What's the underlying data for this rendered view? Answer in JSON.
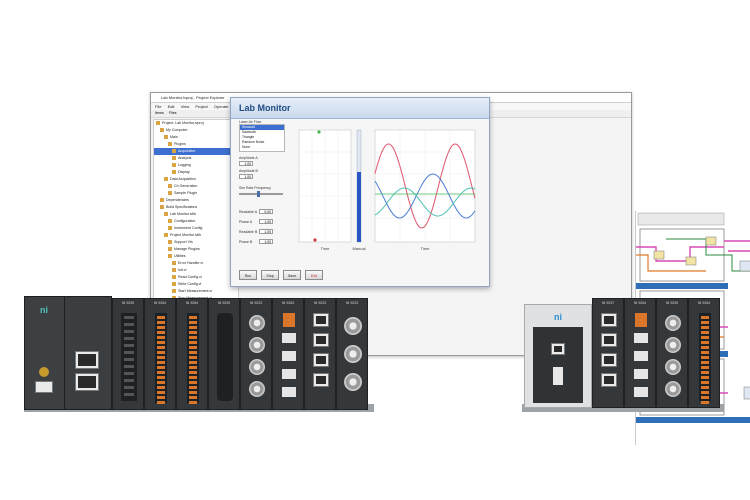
{
  "project_window": {
    "title": "Lab Monitor.lvproj - Project Explorer",
    "menu": [
      "File",
      "Edit",
      "View",
      "Project",
      "Operate",
      "Tools",
      "Window",
      "Help"
    ],
    "tabs": [
      "Items",
      "Files"
    ],
    "tree_items": [
      "Project: Lab Monitor.lvproj",
      "My Computer",
      "Main",
      "Plugins",
      "Acquisition",
      "Analysis",
      "Logging",
      "Display",
      "Data Acquisition",
      "Ch Generation",
      "Sample Plugin",
      "Dependencies",
      "Build Specifications",
      "Lab Monitor.lvlib",
      "Configuration",
      "Instrument Config",
      "Project Monitor.lvlib",
      "Support VIs",
      "Manage Plugins",
      "Utilities",
      "Error Handler.vi",
      "Init.vi",
      "Read Config.vi",
      "Write Config.vi",
      "Start Measurement.vi",
      "Stop Measurement.vi",
      "Dependencies",
      "Build Specifications",
      "Plugin Management",
      "Load Plugins.vi",
      "Unload Plugins.vi",
      "Plugin Manager.vi"
    ]
  },
  "lab_window": {
    "title": "Lab Monitor",
    "list_label": "Laser Air Flow",
    "list_items": [
      "Sinusoid",
      "Sawtooth",
      "Triangle",
      "Random Noise",
      "None"
    ],
    "amplitude_label_1": "Amplitude A",
    "amplitude_label_2": "Amplitude B",
    "amplitude_value_1": "1.00",
    "amplitude_value_2": "1.00",
    "frequency_label": "Sim Rate Frequency",
    "params": [
      {
        "label": "Readable A",
        "value": "0.00"
      },
      {
        "label": "Phase A",
        "value": "1.00"
      },
      {
        "label": "Readable B",
        "value": "1.00"
      },
      {
        "label": "Phase B",
        "value": "1.00"
      }
    ],
    "buttons": [
      "Run",
      "Stop",
      "Save",
      "Exit"
    ],
    "chart_xlabel_left": "Time",
    "chart_xlabel_mid": "Manual",
    "chart_xlabel_right": "Time"
  },
  "hardware": {
    "left_chassis_logo": "ni",
    "right_chassis_logo": "ni",
    "module_labels": [
      "NI 9205",
      "NI 9264",
      "NI 9264",
      "NI 9205",
      "NI 9223",
      "NI 9263",
      "NI 9223",
      "NI 9223",
      "NI 9227"
    ],
    "right_module_labels": [
      "NI 9237",
      "NI 9264",
      "NI 9205",
      "NI 9264"
    ]
  },
  "colors": {
    "accent_blue": "#214b85",
    "wire_pink": "#d94ab5",
    "wire_orange": "#e07a2b",
    "wire_green": "#2e8a3e",
    "sine_red": "#e0546a",
    "sine_blue": "#4a7dd6",
    "sine_teal": "#4ec2b4",
    "module_grey": "#34383b",
    "terminal_orange": "#d9762b"
  }
}
